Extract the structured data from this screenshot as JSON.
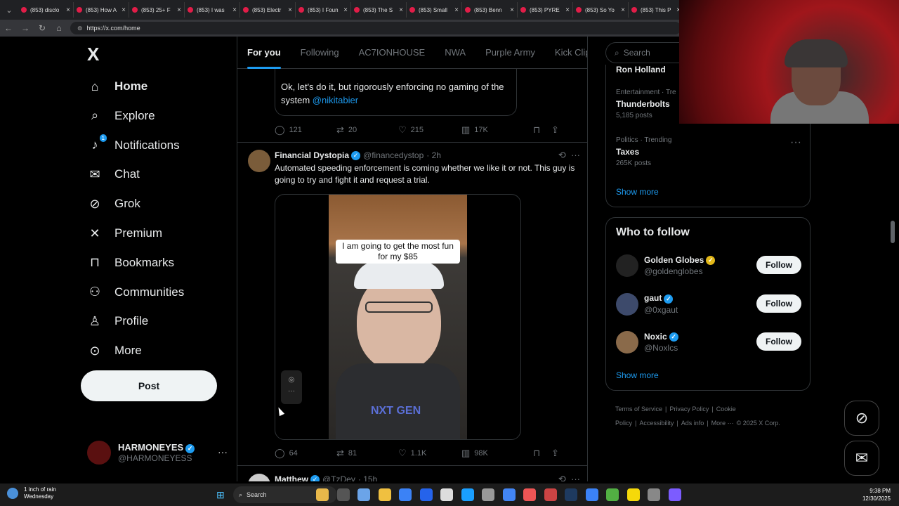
{
  "browser": {
    "tabs": [
      {
        "title": "(853) disclo"
      },
      {
        "title": "(853) How A"
      },
      {
        "title": "(853) 25+ F"
      },
      {
        "title": "(853) I was"
      },
      {
        "title": "(853) Electr"
      },
      {
        "title": "(853) I Foun"
      },
      {
        "title": "(853) The S"
      },
      {
        "title": "(853) Small"
      },
      {
        "title": "(853) Benn"
      },
      {
        "title": "(853) PYRE"
      },
      {
        "title": "(853) So Yo"
      },
      {
        "title": "(853) This P"
      }
    ],
    "url": "https://x.com/home"
  },
  "sidebar": {
    "logo": "X",
    "items": [
      {
        "label": "Home",
        "icon": "home-icon"
      },
      {
        "label": "Explore",
        "icon": "search-icon"
      },
      {
        "label": "Notifications",
        "icon": "bell-icon",
        "badge": "1"
      },
      {
        "label": "Chat",
        "icon": "mail-icon"
      },
      {
        "label": "Grok",
        "icon": "grok-icon"
      },
      {
        "label": "Premium",
        "icon": "x-icon"
      },
      {
        "label": "Bookmarks",
        "icon": "bookmark-icon"
      },
      {
        "label": "Communities",
        "icon": "people-icon"
      },
      {
        "label": "Profile",
        "icon": "person-icon"
      },
      {
        "label": "More",
        "icon": "more-circle-icon"
      }
    ],
    "post_label": "Post",
    "account": {
      "name": "HARMONEYES",
      "handle": "@HARMONEYESS"
    }
  },
  "feed": {
    "tabs": [
      "For you",
      "Following",
      "AC7IONHOUSE",
      "NWA",
      "Purple Army",
      "Kick Clips"
    ],
    "quote_text": "Ok, let's do it, but rigorously enforcing no gaming of the system",
    "quote_mention": "@nikitabier",
    "actions1": {
      "replies": "121",
      "reposts": "20",
      "likes": "215",
      "views": "17K"
    },
    "tweet": {
      "name": "Financial Dystopia",
      "handle": "@financedystop",
      "time": "· 2h",
      "text": "Automated speeding enforcement is coming whether we like it or not. This guy is going to try and fight it and request a trial.",
      "video_caption": "I am going to get the most fun for my $85",
      "shirt_text": "NXT GEN"
    },
    "actions2": {
      "replies": "64",
      "reposts": "81",
      "likes": "1.1K",
      "views": "98K"
    },
    "next_tweet": {
      "name": "Matthew",
      "handle": "@TzDev",
      "time": "· 15h"
    }
  },
  "right": {
    "search_placeholder": "Search",
    "trend0_title": "Ron Holland",
    "trends": [
      {
        "category": "Entertainment · Tre",
        "title": "Thunderbolts",
        "posts": "5,185 posts"
      },
      {
        "category": "Politics · Trending",
        "title": "Taxes",
        "posts": "265K posts"
      }
    ],
    "show_more": "Show more",
    "who_to_follow": "Who to follow",
    "follow_label": "Follow",
    "suggestions": [
      {
        "name": "Golden Globes",
        "handle": "@goldenglobes",
        "color": "#222"
      },
      {
        "name": "gaut",
        "handle": "@0xgaut",
        "color": "#3d4a6b"
      },
      {
        "name": "Noxic",
        "handle": "@Noxlcs",
        "color": "#8a6a4a"
      }
    ],
    "footer": [
      "Terms of Service",
      "|",
      "Privacy Policy",
      "|",
      "Cookie Policy",
      "|",
      "Accessibility",
      "|",
      "Ads info",
      "|",
      "More ···",
      "© 2025 X Corp."
    ]
  },
  "taskbar": {
    "weather_line1": "1 inch of rain",
    "weather_line2": "Wednesday",
    "search": "Search",
    "time": "9:38 PM",
    "date": "12/30/2025"
  },
  "colors": {
    "accent": "#1d9bf0",
    "background": "#000000"
  }
}
